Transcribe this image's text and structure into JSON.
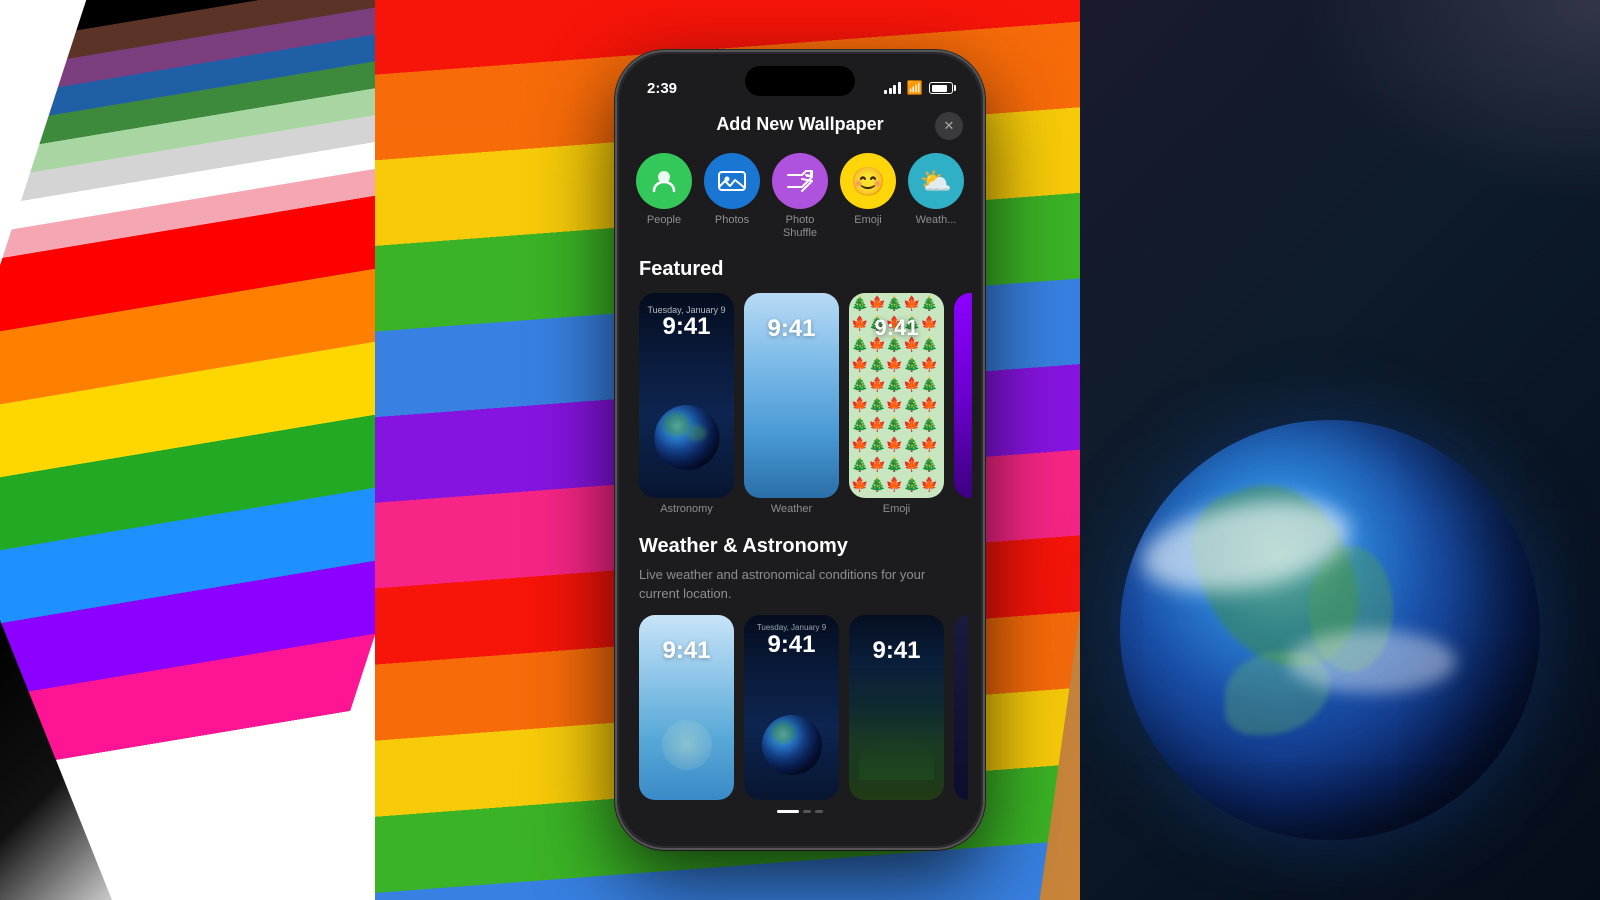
{
  "background": {
    "left_panel_color": "#000000",
    "center_color": "#C8853A",
    "right_panel_color": "#0d1b2a"
  },
  "status_bar": {
    "time": "2:39",
    "signal_label": "signal",
    "wifi_label": "wifi",
    "battery_label": "battery"
  },
  "sheet": {
    "title": "Add New Wallpaper",
    "close_label": "✕"
  },
  "wallpaper_types": [
    {
      "id": "people",
      "label": "People",
      "color_class": "type-people",
      "icon": "👤"
    },
    {
      "id": "photos",
      "label": "Photos",
      "color_class": "type-photos",
      "icon": "🖼"
    },
    {
      "id": "shuffle",
      "label": "Photo Shuffle",
      "color_class": "type-shuffle",
      "icon": "🔀"
    },
    {
      "id": "emoji",
      "label": "Emoji",
      "color_class": "type-emoji",
      "icon": "😊"
    },
    {
      "id": "weather",
      "label": "Weath...",
      "color_class": "type-weather",
      "icon": "⛅"
    }
  ],
  "featured_section": {
    "title": "Featured",
    "thumbnails": [
      {
        "id": "astronomy",
        "time": "9:41",
        "label": "Astronomy",
        "type": "astronomy"
      },
      {
        "id": "weather",
        "time": "9:41",
        "label": "Weather",
        "type": "weather"
      },
      {
        "id": "emoji",
        "time": "9:41",
        "label": "Emoji",
        "type": "emoji"
      }
    ]
  },
  "weather_section": {
    "title": "Weather & Astronomy",
    "description": "Live weather and astronomical conditions for your\ncurrent location.",
    "thumbnails": [
      {
        "id": "blue-sky",
        "time": "9:41",
        "type": "blue-sky"
      },
      {
        "id": "space",
        "time": "9:41",
        "date": "Tuesday, January 9",
        "type": "space"
      },
      {
        "id": "terrain",
        "time": "9:41",
        "type": "terrain"
      }
    ],
    "scroll_indicators": [
      {
        "active": true
      },
      {
        "active": false
      },
      {
        "active": false
      }
    ]
  }
}
